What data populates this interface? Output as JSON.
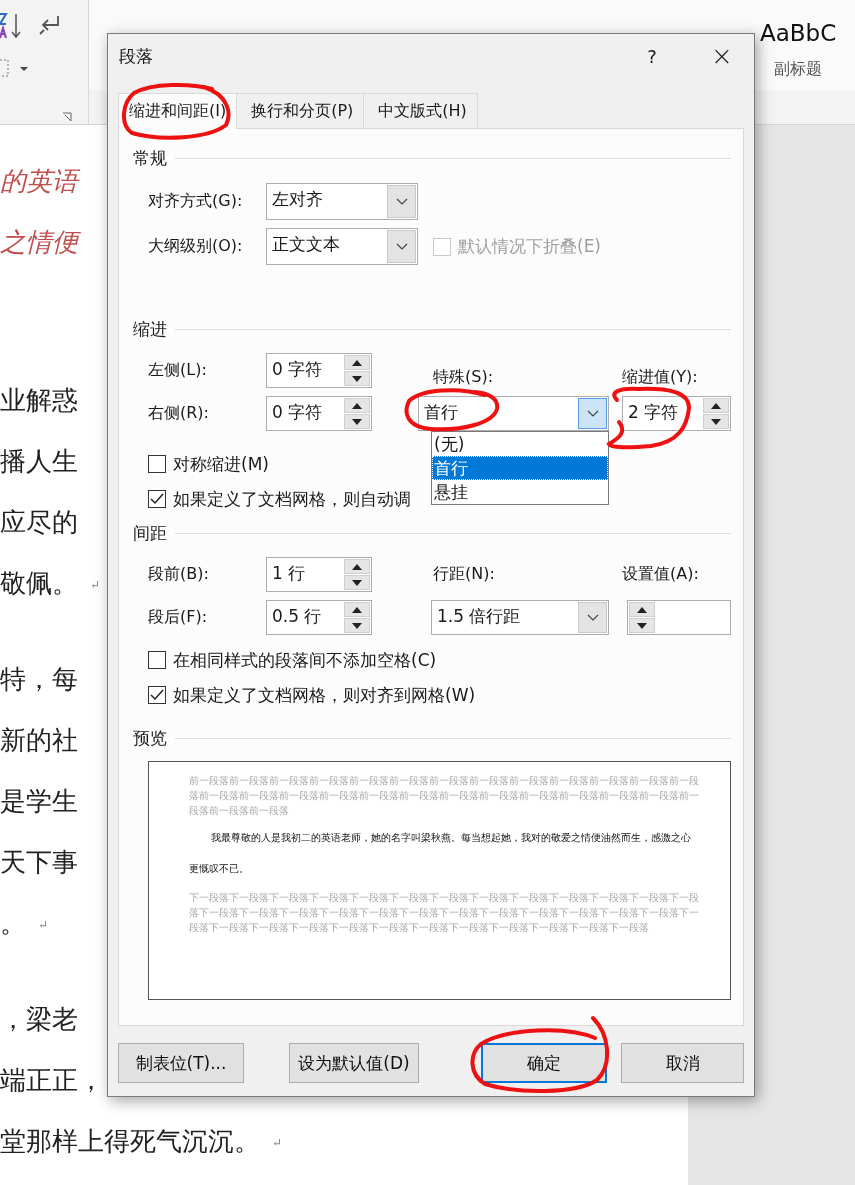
{
  "ribbon": {
    "styles": [
      {
        "sample": "AaBbC",
        "kind": "medium",
        "selected": false,
        "label": "副标题"
      }
    ]
  },
  "document": {
    "paragraphs": [
      {
        "kind": "emphasis",
        "lines": [
          {
            "text": "的英语"
          },
          {
            "text": "之情便"
          }
        ]
      },
      {
        "kind": "body",
        "lines": [
          {
            "text": "业解惑"
          },
          {
            "text": "播人生"
          },
          {
            "text": "应尽的"
          },
          {
            "text": "敬佩。",
            "mark": "↵"
          }
        ]
      },
      {
        "kind": "body",
        "lines": [
          {
            "text": "特，每"
          },
          {
            "text": "新的社"
          },
          {
            "text": "是学生"
          },
          {
            "text": "天下事"
          },
          {
            "text": "。",
            "mark": "↵"
          }
        ]
      },
      {
        "kind": "body",
        "lines": [
          {
            "text": "，梁老"
          },
          {
            "text": "端正正，"
          },
          {
            "text": "堂那样上得死气沉沉。",
            "mark": "↵"
          }
        ]
      }
    ]
  },
  "dialog": {
    "title": "段落",
    "help": "?",
    "close": "×",
    "tabs": [
      {
        "label": "缩进和间距(I)",
        "selected": true
      },
      {
        "label": "换行和分页(P)",
        "selected": false
      },
      {
        "label": "中文版式(H)",
        "selected": false
      }
    ],
    "general": {
      "heading": "常规",
      "alignment": {
        "label": "对齐方式(G):",
        "value": "左对齐"
      },
      "outline": {
        "label": "大纲级别(O):",
        "value": "正文文本"
      },
      "collapse": {
        "label": "默认情况下折叠(E)",
        "checked": false,
        "disabled": true
      }
    },
    "indent": {
      "heading": "缩进",
      "left": {
        "label": "左侧(L):",
        "value": "0 字符"
      },
      "right": {
        "label": "右侧(R):",
        "value": "0 字符"
      },
      "special": {
        "label": "特殊(S):",
        "value": "首行",
        "open": true,
        "options": [
          {
            "label": "(无)",
            "selected": false
          },
          {
            "label": "首行",
            "selected": true
          },
          {
            "label": "悬挂",
            "selected": false
          }
        ]
      },
      "by": {
        "label": "缩进值(Y):",
        "value": "2 字符"
      },
      "mirror": {
        "label": "对称缩进(M)",
        "checked": false,
        "disabled": false
      },
      "auto_adjust": {
        "label": "如果定义了文档网格，则自动调",
        "checked": true,
        "disabled": false
      }
    },
    "spacing": {
      "heading": "间距",
      "before": {
        "label": "段前(B):",
        "value": "1 行"
      },
      "after": {
        "label": "段后(F):",
        "value": "0.5 行"
      },
      "line_spacing": {
        "label": "行距(N):",
        "value": "1.5 倍行距"
      },
      "at": {
        "label": "设置值(A):"
      },
      "no_space": {
        "label": "在相同样式的段落间不添加空格(C)",
        "checked": false,
        "disabled": false
      },
      "snap": {
        "label": "如果定义了文档网格，则对齐到网格(W)",
        "checked": true,
        "disabled": false
      }
    },
    "preview": {
      "heading": "预览",
      "previous": "前一段落前一段落前一段落前一段落前一段落前一段落前一段落前一段落前一段落前一段落前一段落前一段落前一段落前一段落前一段落前一段落前一段落前一段落前一段落前一段落前一段落前一段落前一段落前一段落前一段落前一段落前一段落前一段落",
      "sample": "我最尊敬的人是我初二的英语老师，她的名字叫梁秋燕。每当想起她，我对的敬爱之情便油然而生，感激之心更慨叹不已。",
      "next": "下一段落下一段落下一段落下一段落下一段落下一段落下一段落下一段落下一段落下一段落下一段落下一段落下一段落下一段落下一段落下一段落下一段落下一段落下一段落下一段落下一段落下一段落下一段落下一段落下一段落下一段落下一段落下一段落下一段落下一段落下一段落下一段落下一段落下一段落下一段落下一段落下一段落"
    },
    "buttons": [
      {
        "label": "制表位(T)...",
        "default": false
      },
      {
        "label": "设为默认值(D)",
        "default": false
      },
      {
        "label": "确定",
        "default": true
      },
      {
        "label": "取消",
        "default": false
      }
    ]
  }
}
